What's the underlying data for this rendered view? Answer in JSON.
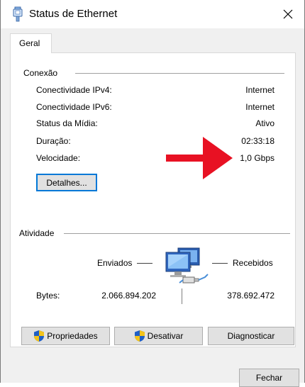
{
  "window": {
    "title": "Status de Ethernet",
    "icon": "ethernet-plug-icon",
    "close_icon": "close-icon"
  },
  "tabs": [
    {
      "label": "Geral",
      "selected": true
    }
  ],
  "connection": {
    "group_label": "Conexão",
    "rows": [
      {
        "label": "Conectividade IPv4:",
        "value": "Internet"
      },
      {
        "label": "Conectividade IPv6:",
        "value": "Internet"
      },
      {
        "label": "Status da Mídia:",
        "value": "Ativo"
      },
      {
        "label": "Duração:",
        "value": "02:33:18"
      },
      {
        "label": "Velocidade:",
        "value": "1,0 Gbps"
      }
    ],
    "details_button": "Detalhes...",
    "annotation": {
      "type": "arrow",
      "color": "#e81123",
      "points_to": "Velocidade"
    }
  },
  "activity": {
    "group_label": "Atividade",
    "sent_label": "Enviados",
    "received_label": "Recebidos",
    "bytes_label": "Bytes:",
    "bytes_sent": "2.066.894.202",
    "bytes_received": "378.692.472",
    "icon": "network-computers-icon"
  },
  "buttons": {
    "properties": "Propriedades",
    "disable": "Desativar",
    "diagnose": "Diagnosticar",
    "close": "Fechar",
    "shield_icon": "uac-shield-icon"
  },
  "colors": {
    "accent": "#0078d7",
    "button_face": "#e1e1e1",
    "window_bg": "#f0f0f0",
    "annotation_red": "#e81123"
  }
}
